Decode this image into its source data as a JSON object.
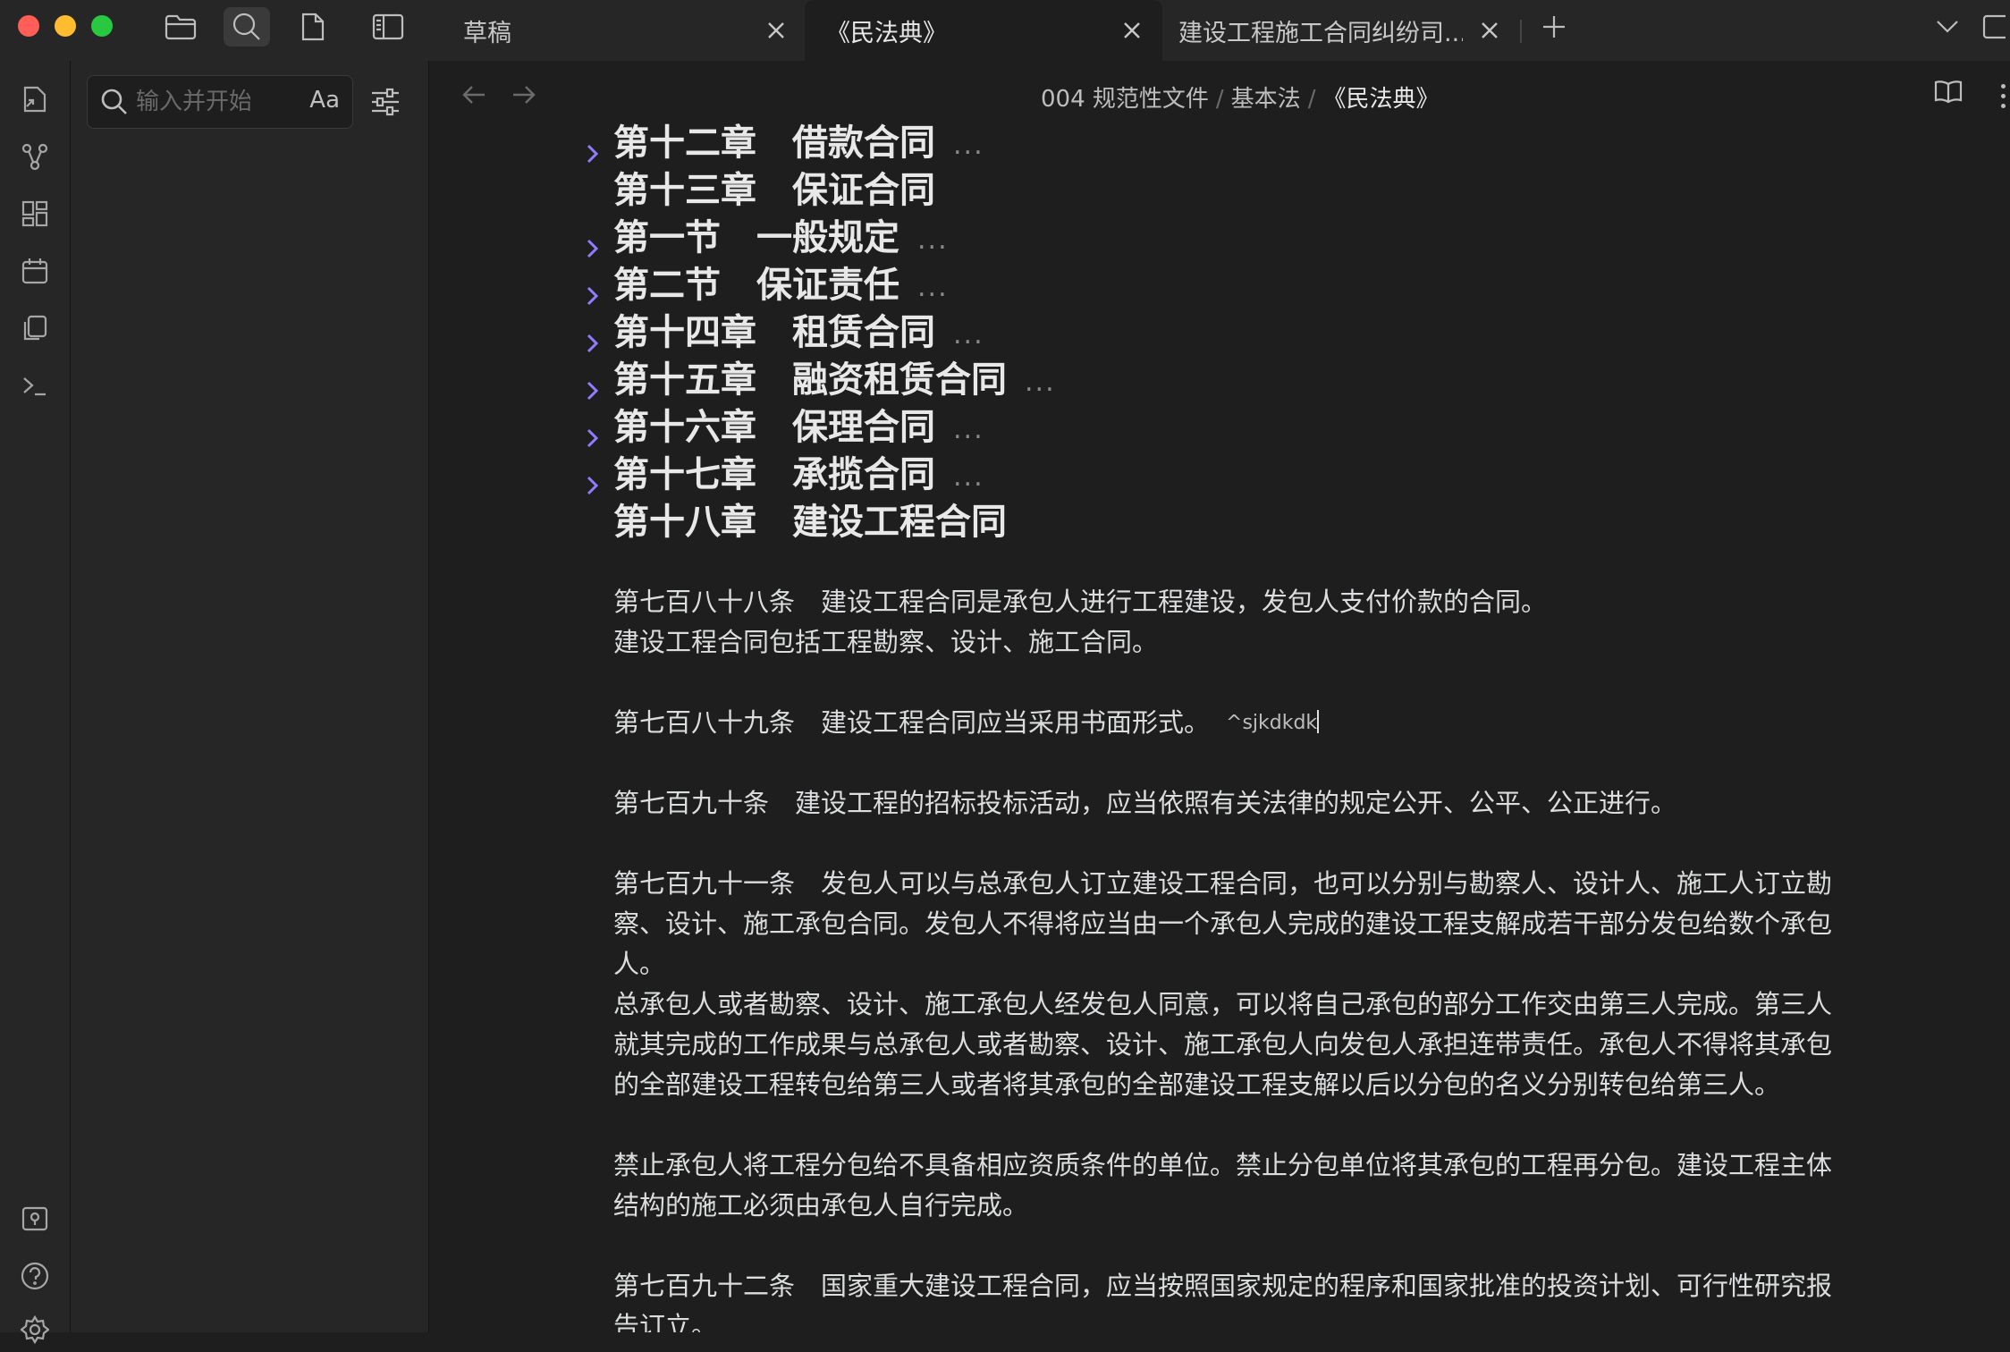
{
  "tabs": [
    {
      "label": "草稿"
    },
    {
      "label": "《民法典》"
    },
    {
      "label": "建设工程施工合同纠纷司..."
    }
  ],
  "search": {
    "placeholder": "输入并开始搜索...",
    "case_toggle": "Aa"
  },
  "breadcrumb": {
    "folder": "004 规范性文件",
    "subfolder": "基本法",
    "current": "《民法典》"
  },
  "outline": [
    {
      "text": "第十二章　借款合同",
      "collapsed": true
    },
    {
      "text": "第十三章　保证合同",
      "collapsed": false
    },
    {
      "text": "第一节　一般规定",
      "collapsed": true
    },
    {
      "text": "第二节　保证责任",
      "collapsed": true
    },
    {
      "text": "第十四章　租赁合同",
      "collapsed": true
    },
    {
      "text": "第十五章　融资租赁合同",
      "collapsed": true
    },
    {
      "text": "第十六章　保理合同",
      "collapsed": true
    },
    {
      "text": "第十七章　承揽合同",
      "collapsed": true
    },
    {
      "text": "第十八章　建设工程合同",
      "collapsed": false
    }
  ],
  "ellipsis": "...",
  "articles": {
    "a788_1": "第七百八十八条　建设工程合同是承包人进行工程建设，发包人支付价款的合同。",
    "a788_2": "建设工程合同包括工程勘察、设计、施工合同。",
    "a789": "第七百八十九条　建设工程合同应当采用书面形式。",
    "a789_block_id": "^sjkdkdk",
    "a790": "第七百九十条　建设工程的招标投标活动，应当依照有关法律的规定公开、公平、公正进行。",
    "a791_1": "第七百九十一条　发包人可以与总承包人订立建设工程合同，也可以分别与勘察人、设计人、施工人订立勘察、设计、施工承包合同。发包人不得将应当由一个承包人完成的建设工程支解成若干部分发包给数个承包人。",
    "a791_2": "总承包人或者勘察、设计、施工承包人经发包人同意，可以将自己承包的部分工作交由第三人完成。第三人就其完成的工作成果与总承包人或者勘察、设计、施工承包人向发包人承担连带责任。承包人不得将其承包的全部建设工程转包给第三人或者将其承包的全部建设工程支解以后以分包的名义分别转包给第三人。",
    "a791_3": "禁止承包人将工程分包给不具备相应资质条件的单位。禁止分包单位将其承包的工程再分包。建设工程主体结构的施工必须由承包人自行完成。",
    "a792": "第七百九十二条　国家重大建设工程合同，应当按照国家规定的程序和国家批准的投资计划、可行性研究报告订立。"
  }
}
